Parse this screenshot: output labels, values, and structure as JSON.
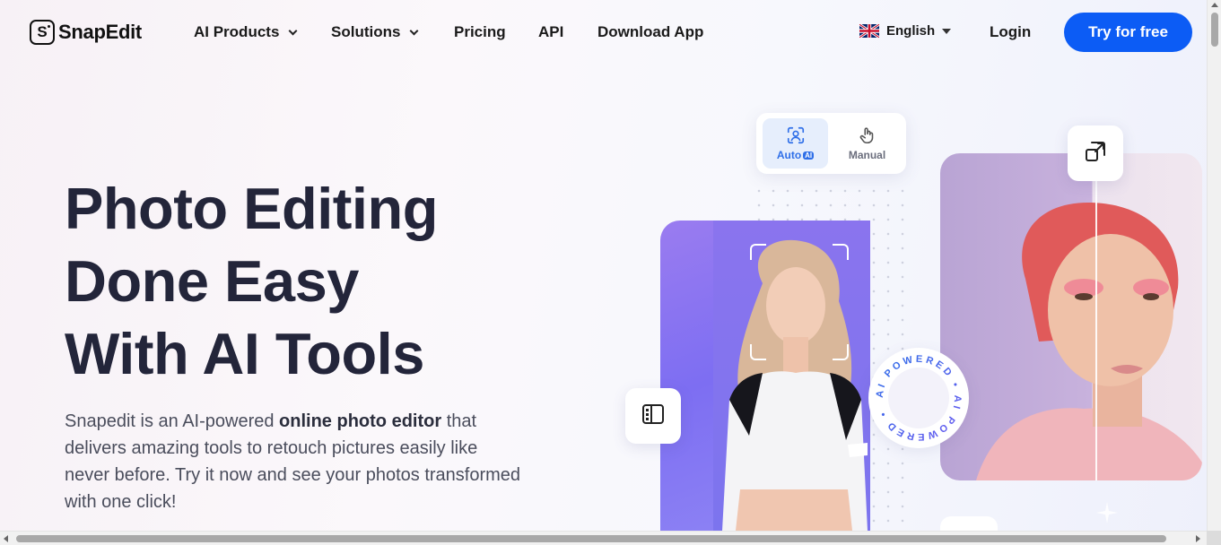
{
  "brand": {
    "name": "SnapEdit",
    "logo_glyph": "S"
  },
  "nav": {
    "items": [
      {
        "label": "AI Products",
        "dropdown": true
      },
      {
        "label": "Solutions",
        "dropdown": true
      },
      {
        "label": "Pricing",
        "dropdown": false
      },
      {
        "label": "API",
        "dropdown": false
      },
      {
        "label": "Download App",
        "dropdown": false
      }
    ],
    "language": "English",
    "login": "Login",
    "cta": "Try for free"
  },
  "hero": {
    "title_lines": [
      "Photo Editing",
      "Done Easy",
      "With AI Tools"
    ],
    "desc_before": "Snapedit is an AI-powered ",
    "desc_bold": "online photo editor",
    "desc_after": " that delivers amazing tools to retouch pictures easily like never before. Try it now and see your photos transformed with one click!"
  },
  "visual": {
    "mode_toggle": {
      "auto_label": "Auto",
      "auto_chip": "AI",
      "manual_label": "Manual",
      "selected": "Auto"
    },
    "badge_text": "AI POWERED • AI POWERED •"
  },
  "colors": {
    "accent": "#0c5cf5",
    "title": "#23253a",
    "text": "#4a4d5c",
    "purple": "#7d6ef2"
  },
  "icons": {
    "logo": "snapedit-logo-icon",
    "flag": "uk-flag-icon",
    "auto": "face-scan-icon",
    "manual": "hand-pointer-icon",
    "side": "compare-panel-icon",
    "expand": "expand-icon",
    "sparkle": "sparkle-icon"
  }
}
